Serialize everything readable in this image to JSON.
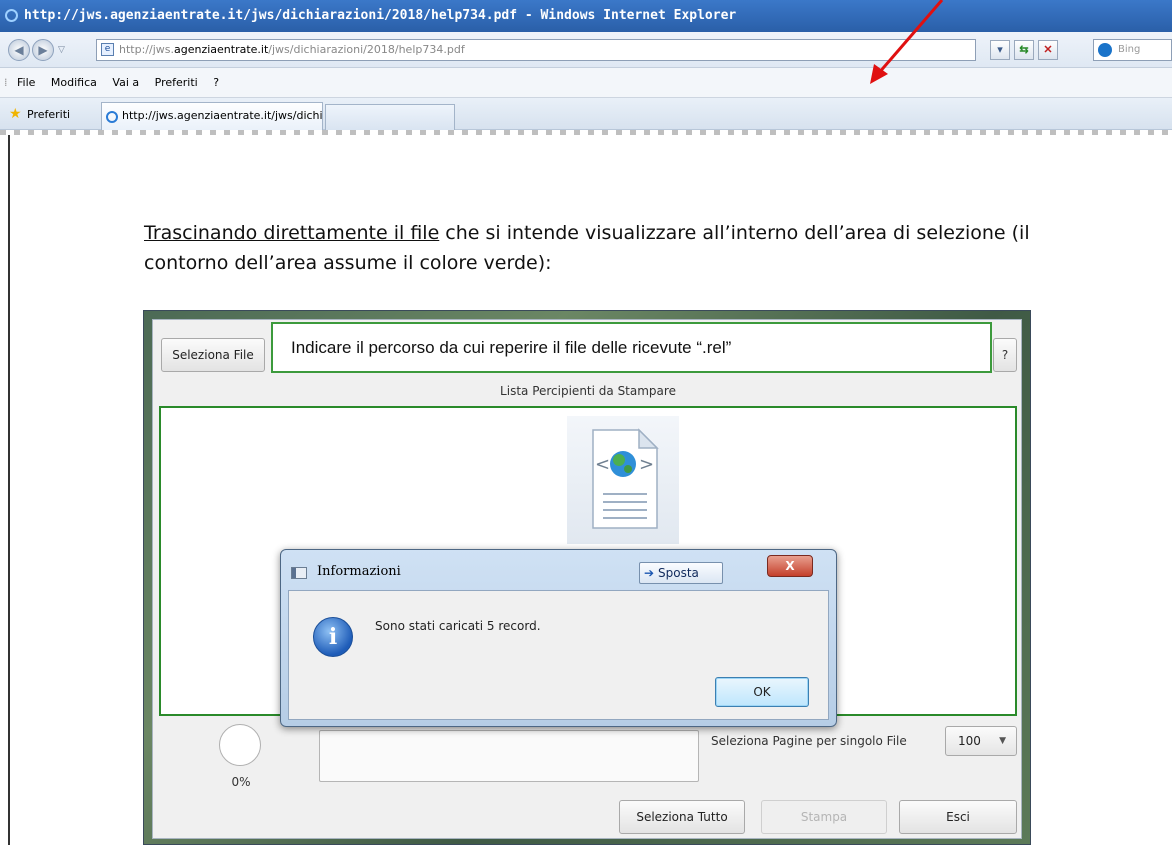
{
  "window": {
    "title": "http://jws.agenziaentrate.it/jws/dichiarazioni/2018/help734.pdf - Windows Internet Explorer"
  },
  "address_bar": {
    "url_prefix": "http://jws.",
    "url_domain": "agenziaentrate.it",
    "url_path": "/jws/dichiarazioni/2018/help734.pdf",
    "search_placeholder": "Bing"
  },
  "menu": {
    "items": [
      "File",
      "Modifica",
      "Vai a",
      "Preferiti",
      "?"
    ]
  },
  "tabs": {
    "favorites_label": "Preferiti",
    "active_tab_label": "http://jws.agenziaentrate.it/jws/dichiarazioni/2018/h..."
  },
  "document": {
    "paragraph_underlined": "Trascinando direttamente il file",
    "paragraph_rest_line1": " che si intende visualizzare all’interno dell’area di selezione (il",
    "paragraph_line2": "contorno dell’area assume il colore verde):"
  },
  "callout": {
    "text": "Indicare il percorso da cui reperire il file delle ricevute “.rel”"
  },
  "app": {
    "select_file_button": "Seleziona File",
    "help_button": "?",
    "list_label": "Lista Percipienti da Stampare",
    "progress_percent": "0%",
    "pages_label": "Seleziona Pagine per singolo File",
    "pages_value": "100",
    "select_all_button": "Seleziona Tutto",
    "print_button": "Stampa",
    "exit_button": "Esci"
  },
  "dialog": {
    "title": "Informazioni",
    "move_button": "Sposta",
    "close_label": "X",
    "message": "Sono stati caricati 5 record.",
    "ok_button": "OK"
  },
  "colors": {
    "drop_area_border": "#2a8a2a",
    "arrow": "#e01010",
    "titlebar": "#2a5fa8"
  }
}
